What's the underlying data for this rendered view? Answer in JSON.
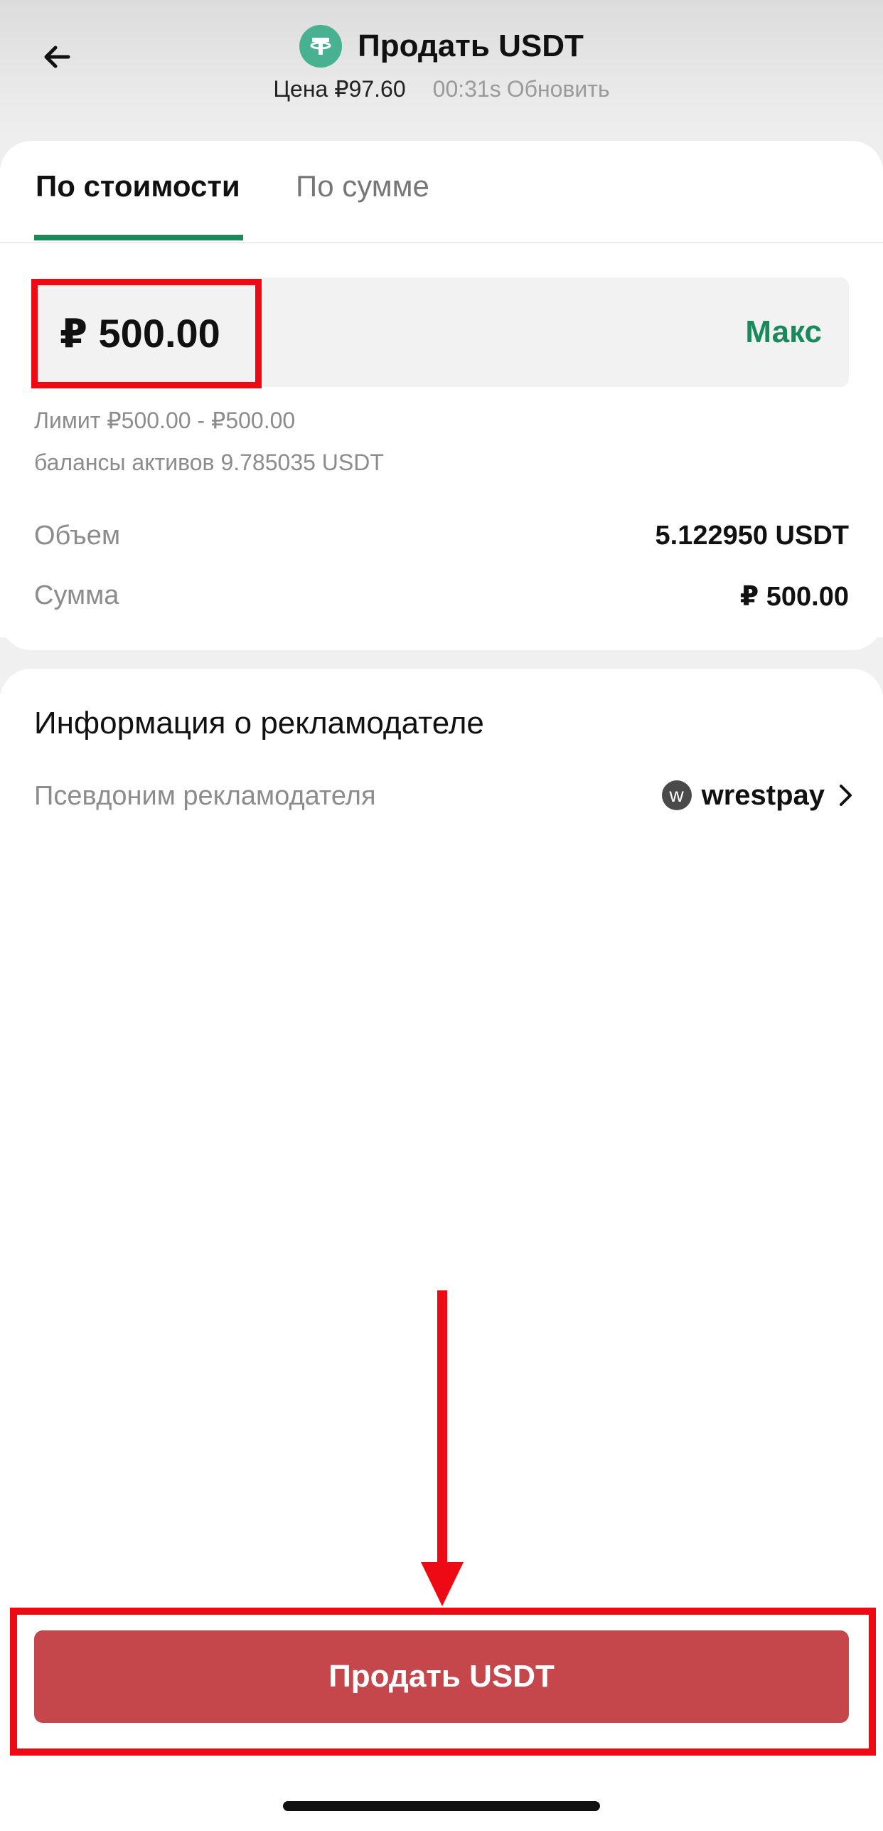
{
  "header": {
    "title": "Продать USDT",
    "price": "Цена ₽97.60",
    "timer": "00:31s",
    "refresh_label": "Обновить",
    "coin_icon": "tether-icon",
    "back_icon": "arrow-left-icon"
  },
  "tabs": [
    {
      "label": "По стоимости",
      "active": true
    },
    {
      "label": "По сумме",
      "active": false
    }
  ],
  "amount": {
    "value": "₽ 500.00",
    "max_label": "Макс"
  },
  "limit_text": "Лимит ₽500.00 - ₽500.00",
  "balance_text": "балансы активов 9.785035 USDT",
  "summary": {
    "volume_label": "Объем",
    "volume_value": "5.122950 USDT",
    "sum_label": "Сумма",
    "sum_value": "₽ 500.00"
  },
  "advertiser": {
    "heading": "Информация о рекламодателе",
    "nickname_label": "Псевдоним рекламодателя",
    "avatar_letter": "w",
    "name": "wrestpay"
  },
  "action": {
    "sell_label": "Продать USDT"
  },
  "colors": {
    "accent_green": "#1a8a5c",
    "sell_button": "#c5474b",
    "annotation_red": "#ee0a14",
    "coin_green": "#48b190"
  }
}
